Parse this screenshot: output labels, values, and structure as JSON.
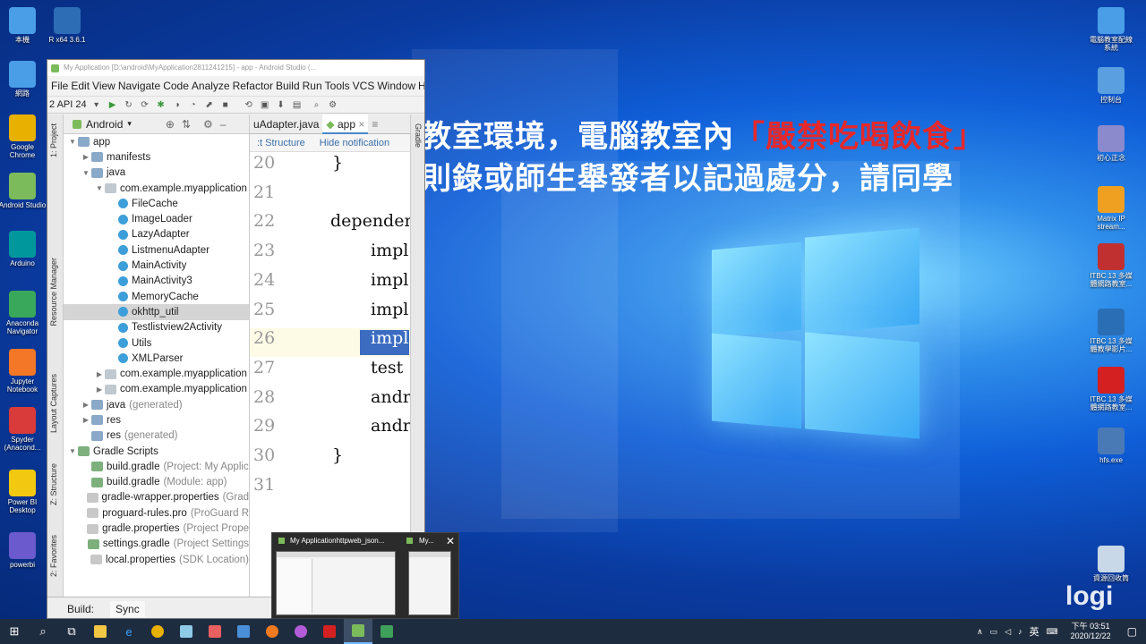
{
  "desktop": {
    "left_icons": [
      {
        "label": "本機"
      },
      {
        "label": "R x64 3.6.1"
      },
      {
        "label": "網路"
      },
      {
        "label": "Google Chrome"
      },
      {
        "label": "Android Studio"
      },
      {
        "label": "Arduino"
      },
      {
        "label": "Anaconda Navigator"
      },
      {
        "label": "Jupyter Notebook"
      },
      {
        "label": "Spyder (Anacond..."
      },
      {
        "label": "Power BI Desktop"
      },
      {
        "label": "powerbi"
      }
    ],
    "right_icons": [
      {
        "label": "電腦教室配線系統"
      },
      {
        "label": "控制台"
      },
      {
        "label": "初心正念"
      },
      {
        "label": "Matrix IP stream..."
      },
      {
        "label": "ITBC 13 多媒體網路教室..."
      },
      {
        "label": "ITBC 13 多媒體教學影片..."
      },
      {
        "label": "ITBC 13 多媒體網路教室..."
      },
      {
        "label": "hfs.exe"
      },
      {
        "label": "資源回收筒"
      }
    ],
    "overlay_line1_pre": "教室環境，電腦教室內",
    "overlay_line1_red": "「嚴禁吃喝飲食」",
    "overlay_line2": "則錄或師生舉發者以記過處分，請同學",
    "watermark": "logi"
  },
  "android_studio": {
    "title": "My Application [D:\\android\\MyApplication2811241215] - app - Android Studio (...",
    "menu": [
      "File",
      "Edit",
      "View",
      "Navigate",
      "Code",
      "Analyze",
      "Refactor",
      "Build",
      "Run",
      "Tools",
      "VCS",
      "Window",
      "Help"
    ],
    "device": "2 API 24",
    "project_view": "Android",
    "tree": [
      {
        "indent": 0,
        "arrow": "▼",
        "icon": "folder",
        "label": "app",
        "extra": ""
      },
      {
        "indent": 1,
        "arrow": "▶",
        "icon": "folder",
        "label": "manifests",
        "extra": ""
      },
      {
        "indent": 1,
        "arrow": "▼",
        "icon": "folder",
        "label": "java",
        "extra": ""
      },
      {
        "indent": 2,
        "arrow": "▼",
        "icon": "pkg",
        "label": "com.example.myapplication",
        "extra": ""
      },
      {
        "indent": 3,
        "arrow": "",
        "icon": "class",
        "label": "FileCache",
        "extra": ""
      },
      {
        "indent": 3,
        "arrow": "",
        "icon": "class",
        "label": "ImageLoader",
        "extra": ""
      },
      {
        "indent": 3,
        "arrow": "",
        "icon": "class",
        "label": "LazyAdapter",
        "extra": ""
      },
      {
        "indent": 3,
        "arrow": "",
        "icon": "class",
        "label": "ListmenuAdapter",
        "extra": ""
      },
      {
        "indent": 3,
        "arrow": "",
        "icon": "class",
        "label": "MainActivity",
        "extra": ""
      },
      {
        "indent": 3,
        "arrow": "",
        "icon": "class",
        "label": "MainActivity3",
        "extra": ""
      },
      {
        "indent": 3,
        "arrow": "",
        "icon": "class",
        "label": "MemoryCache",
        "extra": ""
      },
      {
        "indent": 3,
        "arrow": "",
        "icon": "class",
        "label": "okhttp_util",
        "extra": "",
        "selected": true
      },
      {
        "indent": 3,
        "arrow": "",
        "icon": "class",
        "label": "Testlistview2Activity",
        "extra": ""
      },
      {
        "indent": 3,
        "arrow": "",
        "icon": "class",
        "label": "Utils",
        "extra": ""
      },
      {
        "indent": 3,
        "arrow": "",
        "icon": "class",
        "label": "XMLParser",
        "extra": ""
      },
      {
        "indent": 2,
        "arrow": "▶",
        "icon": "pkg",
        "label": "com.example.myapplication",
        "extra": ""
      },
      {
        "indent": 2,
        "arrow": "▶",
        "icon": "pkg",
        "label": "com.example.myapplication",
        "extra": ""
      },
      {
        "indent": 1,
        "arrow": "▶",
        "icon": "folder",
        "label": "java",
        "extra": "(generated)"
      },
      {
        "indent": 1,
        "arrow": "▶",
        "icon": "folder",
        "label": "res",
        "extra": ""
      },
      {
        "indent": 1,
        "arrow": "",
        "icon": "folder",
        "label": "res",
        "extra": "(generated)"
      },
      {
        "indent": 0,
        "arrow": "▼",
        "icon": "gradle",
        "label": "Gradle Scripts",
        "extra": ""
      },
      {
        "indent": 1,
        "arrow": "",
        "icon": "gradle",
        "label": "build.gradle",
        "extra": "(Project: My Applic"
      },
      {
        "indent": 1,
        "arrow": "",
        "icon": "gradle",
        "label": "build.gradle",
        "extra": "(Module: app)"
      },
      {
        "indent": 1,
        "arrow": "",
        "icon": "file",
        "label": "gradle-wrapper.properties",
        "extra": "(Grad"
      },
      {
        "indent": 1,
        "arrow": "",
        "icon": "file",
        "label": "proguard-rules.pro",
        "extra": "(ProGuard R"
      },
      {
        "indent": 1,
        "arrow": "",
        "icon": "file",
        "label": "gradle.properties",
        "extra": "(Project Prope"
      },
      {
        "indent": 1,
        "arrow": "",
        "icon": "gradle",
        "label": "settings.gradle",
        "extra": "(Project Settings"
      },
      {
        "indent": 1,
        "arrow": "",
        "icon": "file",
        "label": "local.properties",
        "extra": "(SDK Location)"
      }
    ],
    "tabs": [
      "uAdapter.java",
      "app"
    ],
    "notif_left": ":t Structure",
    "notif_right": "Hide notification",
    "code": [
      {
        "ln": "20",
        "text": "}"
      },
      {
        "ln": "21",
        "text": ""
      },
      {
        "ln": "22",
        "text": "dependenc"
      },
      {
        "ln": "23",
        "text": "impl"
      },
      {
        "ln": "24",
        "text": "impl"
      },
      {
        "ln": "25",
        "text": "impl"
      },
      {
        "ln": "26",
        "text": "impl"
      },
      {
        "ln": "27",
        "text": "test"
      },
      {
        "ln": "28",
        "text": "andr"
      },
      {
        "ln": "29",
        "text": "andr"
      },
      {
        "ln": "30",
        "text": "}"
      },
      {
        "ln": "31",
        "text": ""
      }
    ],
    "left_tabs": [
      "1: Project",
      "Resource Manager",
      "Layout Captures",
      "Z: Structure",
      "2: Favorites",
      "Build Variants"
    ],
    "right_tab": "Gradle",
    "bottom": [
      "Build:",
      "Sync"
    ]
  },
  "thumbnails": {
    "first_title": "My Applicationhttpweb_json...",
    "second_title": "My..."
  },
  "taskbar": {
    "time": "下午 03:51",
    "date": "2020/12/22",
    "ime": "英"
  }
}
